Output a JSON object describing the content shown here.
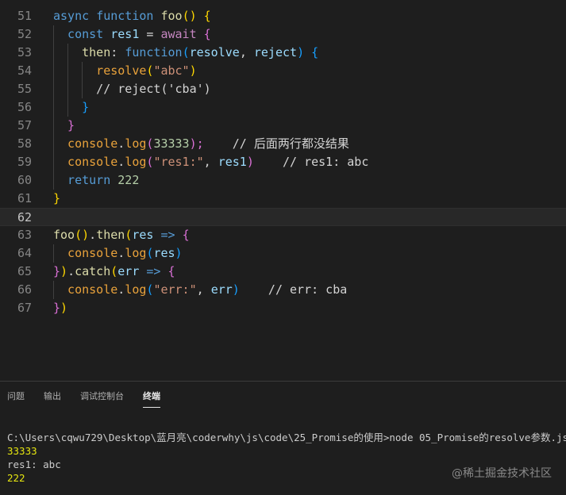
{
  "colors": {
    "keyword_blue": "#569cd6",
    "function_yellow": "#dcdcaa",
    "variable": "#9cdcfe",
    "param": "#4fc1ff",
    "string": "#ce9178",
    "number": "#b5cea8",
    "comment": "#d4d4d4",
    "default": "#d4d4d4",
    "brace_gold": "#ffd700",
    "brace_purple": "#da70d6",
    "brace_blue": "#179fff",
    "console_orange": "#e9a23b"
  },
  "editor": {
    "lines": [
      {
        "number": "51",
        "tokens": [
          {
            "t": "async ",
            "c": "#569cd6"
          },
          {
            "t": "function ",
            "c": "#569cd6"
          },
          {
            "t": "foo",
            "c": "#dcdcaa"
          },
          {
            "t": "() ",
            "c": "#ffd700"
          },
          {
            "t": "{",
            "c": "#ffd700"
          }
        ]
      },
      {
        "number": "52",
        "tokens": [
          {
            "t": "  const ",
            "c": "#569cd6"
          },
          {
            "t": "res1",
            "c": "#9cdcfe"
          },
          {
            "t": " = ",
            "c": "#d4d4d4"
          },
          {
            "t": "await ",
            "c": "#c586c0"
          },
          {
            "t": "{",
            "c": "#da70d6"
          }
        ]
      },
      {
        "number": "53",
        "tokens": [
          {
            "t": "    then",
            "c": "#dcdcaa"
          },
          {
            "t": ": ",
            "c": "#d4d4d4"
          },
          {
            "t": "function",
            "c": "#569cd6"
          },
          {
            "t": "(",
            "c": "#179fff"
          },
          {
            "t": "resolve",
            "c": "#9cdcfe"
          },
          {
            "t": ", ",
            "c": "#d4d4d4"
          },
          {
            "t": "reject",
            "c": "#9cdcfe"
          },
          {
            "t": ") ",
            "c": "#179fff"
          },
          {
            "t": "{",
            "c": "#179fff"
          }
        ]
      },
      {
        "number": "54",
        "tokens": [
          {
            "t": "      resolve",
            "c": "#e9a23b"
          },
          {
            "t": "(",
            "c": "#ffd700"
          },
          {
            "t": "\"abc\"",
            "c": "#ce9178"
          },
          {
            "t": ")",
            "c": "#ffd700"
          }
        ]
      },
      {
        "number": "55",
        "tokens": [
          {
            "t": "      // reject('cba')",
            "c": "#d4d4d4"
          }
        ]
      },
      {
        "number": "56",
        "tokens": [
          {
            "t": "    }",
            "c": "#179fff"
          }
        ]
      },
      {
        "number": "57",
        "tokens": [
          {
            "t": "  }",
            "c": "#da70d6"
          }
        ]
      },
      {
        "number": "58",
        "tokens": [
          {
            "t": "  console",
            "c": "#e9a23b"
          },
          {
            "t": ".",
            "c": "#d4d4d4"
          },
          {
            "t": "log",
            "c": "#e9a23b"
          },
          {
            "t": "(",
            "c": "#da70d6"
          },
          {
            "t": "33333",
            "c": "#b5cea8"
          },
          {
            "t": ");",
            "c": "#da70d6"
          },
          {
            "t": "    // 后面两行都没结果",
            "c": "#d4d4d4"
          }
        ]
      },
      {
        "number": "59",
        "tokens": [
          {
            "t": "  console",
            "c": "#e9a23b"
          },
          {
            "t": ".",
            "c": "#d4d4d4"
          },
          {
            "t": "log",
            "c": "#e9a23b"
          },
          {
            "t": "(",
            "c": "#da70d6"
          },
          {
            "t": "\"res1:\"",
            "c": "#ce9178"
          },
          {
            "t": ", ",
            "c": "#d4d4d4"
          },
          {
            "t": "res1",
            "c": "#9cdcfe"
          },
          {
            "t": ")",
            "c": "#da70d6"
          },
          {
            "t": "    // res1: abc",
            "c": "#d4d4d4"
          }
        ]
      },
      {
        "number": "60",
        "tokens": [
          {
            "t": "  return ",
            "c": "#569cd6"
          },
          {
            "t": "222",
            "c": "#b5cea8"
          }
        ]
      },
      {
        "number": "61",
        "tokens": [
          {
            "t": "}",
            "c": "#ffd700"
          }
        ]
      },
      {
        "number": "62",
        "tokens": []
      },
      {
        "number": "63",
        "tokens": [
          {
            "t": "foo",
            "c": "#dcdcaa"
          },
          {
            "t": "()",
            "c": "#ffd700"
          },
          {
            "t": ".",
            "c": "#d4d4d4"
          },
          {
            "t": "then",
            "c": "#dcdcaa"
          },
          {
            "t": "(",
            "c": "#ffd700"
          },
          {
            "t": "res",
            "c": "#9cdcfe"
          },
          {
            "t": " => ",
            "c": "#569cd6"
          },
          {
            "t": "{",
            "c": "#da70d6"
          }
        ]
      },
      {
        "number": "64",
        "tokens": [
          {
            "t": "  console",
            "c": "#e9a23b"
          },
          {
            "t": ".",
            "c": "#d4d4d4"
          },
          {
            "t": "log",
            "c": "#e9a23b"
          },
          {
            "t": "(",
            "c": "#179fff"
          },
          {
            "t": "res",
            "c": "#9cdcfe"
          },
          {
            "t": ")",
            "c": "#179fff"
          }
        ]
      },
      {
        "number": "65",
        "tokens": [
          {
            "t": "}",
            "c": "#da70d6"
          },
          {
            "t": ")",
            "c": "#ffd700"
          },
          {
            "t": ".",
            "c": "#d4d4d4"
          },
          {
            "t": "catch",
            "c": "#dcdcaa"
          },
          {
            "t": "(",
            "c": "#ffd700"
          },
          {
            "t": "err",
            "c": "#9cdcfe"
          },
          {
            "t": " => ",
            "c": "#569cd6"
          },
          {
            "t": "{",
            "c": "#da70d6"
          }
        ]
      },
      {
        "number": "66",
        "tokens": [
          {
            "t": "  console",
            "c": "#e9a23b"
          },
          {
            "t": ".",
            "c": "#d4d4d4"
          },
          {
            "t": "log",
            "c": "#e9a23b"
          },
          {
            "t": "(",
            "c": "#179fff"
          },
          {
            "t": "\"err:\"",
            "c": "#ce9178"
          },
          {
            "t": ", ",
            "c": "#d4d4d4"
          },
          {
            "t": "err",
            "c": "#9cdcfe"
          },
          {
            "t": ")",
            "c": "#179fff"
          },
          {
            "t": "    // err: cba",
            "c": "#d4d4d4"
          }
        ]
      },
      {
        "number": "67",
        "tokens": [
          {
            "t": "}",
            "c": "#da70d6"
          },
          {
            "t": ")",
            "c": "#ffd700"
          }
        ]
      }
    ],
    "current_line": "62"
  },
  "panel": {
    "tabs": [
      {
        "label": "问题",
        "active": false
      },
      {
        "label": "输出",
        "active": false
      },
      {
        "label": "调试控制台",
        "active": false
      },
      {
        "label": "终端",
        "active": true
      }
    ],
    "terminal": {
      "lines": [
        {
          "text": "C:\\Users\\cqwu729\\Desktop\\蓝月亮\\coderwhy\\js\\code\\25_Promise的使用>node 05_Promise的resolve参数.js",
          "accent": false
        },
        {
          "text": "33333",
          "accent": true
        },
        {
          "text": "res1: abc",
          "accent": false
        },
        {
          "text": "222",
          "accent": true
        }
      ]
    }
  },
  "watermark": "@稀土掘金技术社区"
}
